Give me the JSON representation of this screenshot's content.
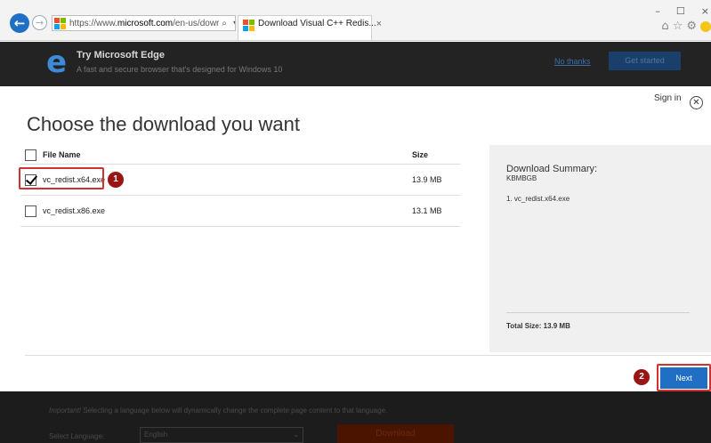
{
  "browser": {
    "back_icon": "arrow-left-icon",
    "forward_icon": "arrow-right-icon",
    "url_prefix": "https://www.",
    "url_domain": "microsoft.com",
    "url_suffix": "/en-us/dowr",
    "address_icons": "⌕ ▾ 🔒 ↻",
    "tab_title": "Download Visual C++ Redis...",
    "tab_close": "×",
    "window_controls": [
      "–",
      "☐",
      "×"
    ],
    "tool_icons": [
      "⌂",
      "☆",
      "⚙"
    ],
    "ms_colors": [
      "#f25022",
      "#7fba00",
      "#00a4ef",
      "#ffb900"
    ]
  },
  "edge_banner": {
    "logo": "e",
    "title": "Try Microsoft Edge",
    "subtitle": "A fast and secure browser that's designed for Windows 10",
    "no_thanks": "No thanks",
    "get_started": "Get started"
  },
  "dialog": {
    "sign_in": "Sign in",
    "close": "✕",
    "heading": "Choose the download you want",
    "columns": {
      "name": "File Name",
      "size": "Size"
    },
    "files": [
      {
        "name": "vc_redist.x64.exe",
        "size": "13.9 MB",
        "checked": true
      },
      {
        "name": "vc_redist.x86.exe",
        "size": "13.1 MB",
        "checked": false
      }
    ],
    "summary": {
      "title": "Download Summary:",
      "code": "KBMBGB",
      "item": "1. vc_redist.x64.exe",
      "total": "Total Size: 13.9 MB"
    },
    "next": "Next",
    "callouts": [
      "1",
      "2"
    ],
    "accent": "#1f6fc5",
    "highlight": "#d23131"
  },
  "background_page": {
    "important_label": "Important!",
    "note": " Selecting a language below will dynamically change the complete page content to that language.",
    "select_label": "Select Language:",
    "select_value": "English",
    "download": "Download"
  }
}
